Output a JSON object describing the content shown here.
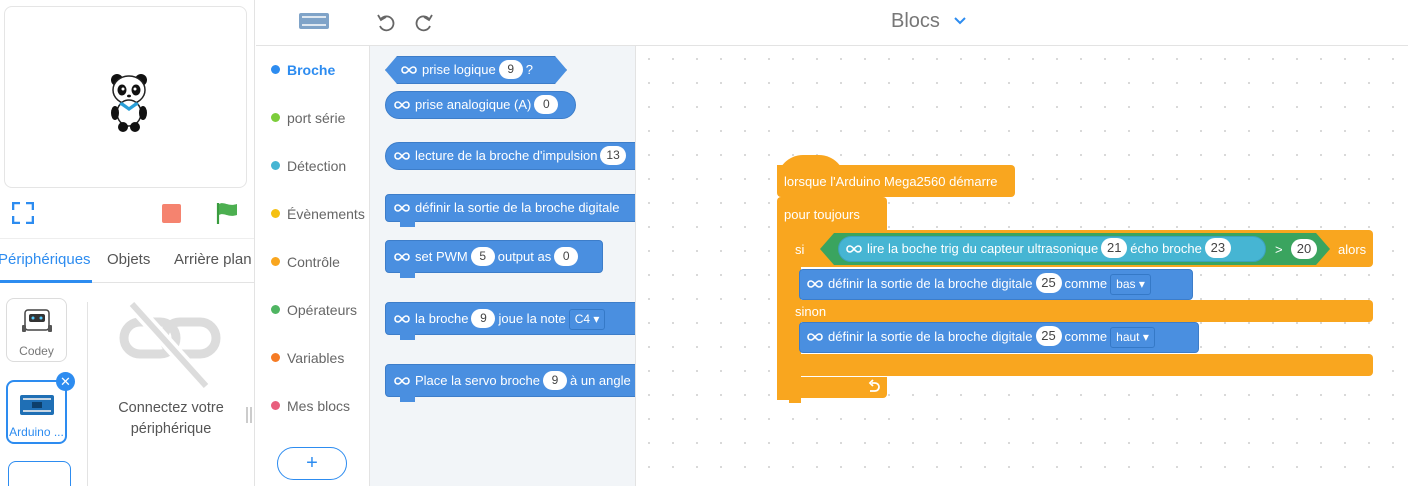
{
  "stage": {
    "sprite_icon": "panda-sprite",
    "controls": {
      "fullscreen_icon": "fullscreen-icon",
      "stop_icon": "stop-icon",
      "go_icon": "green-flag-icon"
    }
  },
  "tabs": [
    "Périphériques",
    "Objets",
    "Arrière plan"
  ],
  "devices": {
    "items": [
      {
        "label": "Codey",
        "icon": "codey-robot-icon"
      },
      {
        "label": "Arduino ...",
        "icon": "arduino-board-icon",
        "selected": true
      }
    ],
    "remove_glyph": "✕",
    "empty_icon": "disconnected-link-icon",
    "connect_line1": "Connectez votre",
    "connect_line2": "périphérique"
  },
  "topbar": {
    "title": "Blocs",
    "title_icon": "chevron-down-icon",
    "undo_icon": "undo-icon",
    "redo_icon": "redo-icon",
    "board_icon": "arduino-board-icon"
  },
  "categories": [
    {
      "label": "Broche",
      "color": "#2d8cf0",
      "active": true
    },
    {
      "label": "port série",
      "color": "#7ccd3b"
    },
    {
      "label": "Détection",
      "color": "#46b5d3"
    },
    {
      "label": "Évènements",
      "color": "#f5c011"
    },
    {
      "label": "Contrôle",
      "color": "#f9a61f"
    },
    {
      "label": "Opérateurs",
      "color": "#4fb562"
    },
    {
      "label": "Variables",
      "color": "#f57b25"
    },
    {
      "label": "Mes blocs",
      "color": "#e85f7d"
    }
  ],
  "add_extension_label": "+",
  "palette": {
    "digital_read": {
      "label": "prise logique",
      "pin": "9",
      "suffix": "?"
    },
    "analog_read": {
      "label": "prise analogique (A)",
      "pin": "0"
    },
    "pulse_read": {
      "label": "lecture de la broche d'impulsion",
      "pin": "13"
    },
    "digital_write": {
      "label": "définir la sortie de la broche digitale"
    },
    "pwm": {
      "label": "set PWM",
      "pin": "5",
      "mid": "output as",
      "value": "0"
    },
    "tone": {
      "label": "la broche",
      "pin": "9",
      "mid": "joue la note",
      "note": "C4"
    },
    "servo": {
      "label": "Place la servo broche",
      "pin": "9",
      "mid": "à un angle"
    }
  },
  "script": {
    "hat": "lorsque l'Arduino Mega2560 démarre",
    "forever": "pour toujours",
    "if_label": "si",
    "then_label": "alors",
    "else_label": "sinon",
    "condition": {
      "sensor_label": "lire la boche trig du capteur ultrasonique",
      "trig_pin": "21",
      "echo_label": "écho broche",
      "echo_pin": "23",
      "operator": ">",
      "threshold": "20"
    },
    "then_block": {
      "label": "définir la sortie de la broche digitale",
      "pin": "25",
      "mid": "comme",
      "value": "bas"
    },
    "else_block": {
      "label": "définir la sortie de la broche digitale",
      "pin": "25",
      "mid": "comme",
      "value": "haut"
    },
    "loop_arrow_icon": "loop-arrow-icon"
  },
  "extension_icon": "infinity-link-icon",
  "colors": {
    "accent": "#2d8cf0",
    "pin_block": "#4a8fe0",
    "control": "#f9a61f",
    "operator": "#3aa45f",
    "sensor": "#46b5d3",
    "stop": "#f5836f",
    "go": "#4caf50"
  }
}
